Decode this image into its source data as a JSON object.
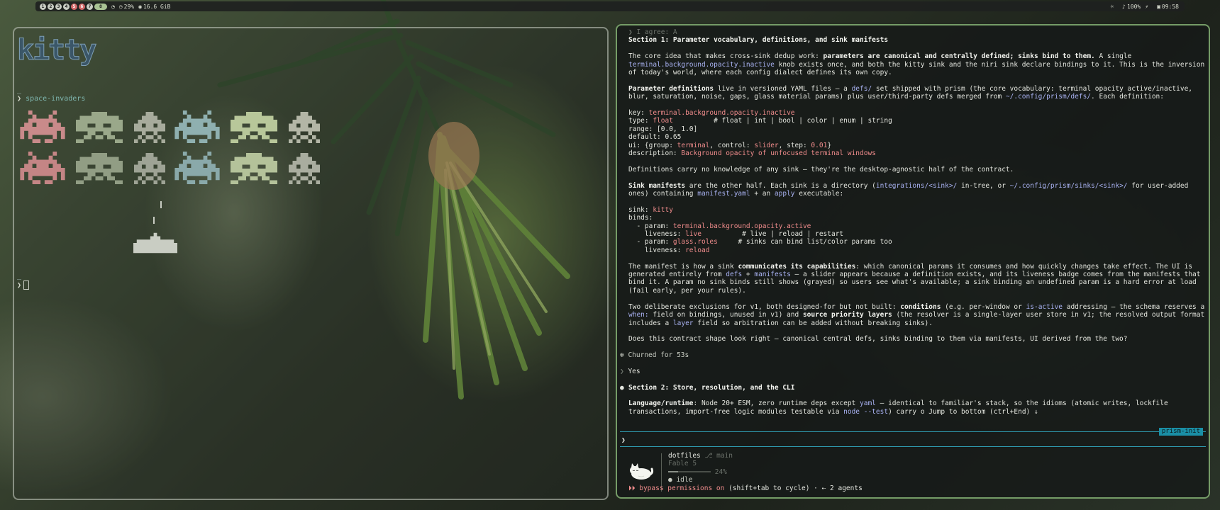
{
  "colors": {
    "accent_blue": "#a9b2f2",
    "accent_pink": "#f08c8c",
    "accent_yellow": "#e8d27e",
    "frame_green": "#96c882",
    "separator_teal": "#2f9bb0"
  },
  "topbar": {
    "workspaces": [
      "1",
      "2",
      "3",
      "4",
      "5",
      "6",
      "7",
      "8"
    ],
    "alert_workspaces": [
      "5",
      "6"
    ],
    "active_workspace": "8",
    "battery": "29%",
    "memory": "16.6 GiB",
    "volume": "100%",
    "clock": "09:58",
    "icons": [
      "speed-icon",
      "memory-icon",
      "brightness-icon",
      "volume-icon",
      "network-icon",
      "battery-icon"
    ]
  },
  "left_terminal": {
    "logo_text": "kitty",
    "prompt_symbol": "❯",
    "command": "space-invaders",
    "underscore": "_",
    "underscore2": "_",
    "prompt2": "❯"
  },
  "right_terminal": {
    "prev_prompt": "❯ I agree: A",
    "section1_title": "Section 1: Parameter vocabulary, definitions, and sink manifests",
    "p1_a": "The core idea that makes cross-sink dedup work: ",
    "p1_b": "parameters are canonical and centrally defined; sinks bind to them.",
    "p1_c": " A single ",
    "p1_d": "terminal.background.opacity.inactive",
    "p1_e": " knob exists once, and both the kitty sink and the niri sink declare bindings to it. This is the inversion of today's world, where each config dialect defines its own copy.",
    "p2_a": "Parameter definitions",
    "p2_b": " live in versioned YAML files — a ",
    "p2_c": "defs/",
    "p2_d": " set shipped with prism (the core vocabulary: terminal opacity active/inactive, blur, saturation, noise, gaps, glass material params) plus user/third-party defs merged from ",
    "p2_e": "~/.config/prism/defs/",
    "p2_f": ". Each definition:",
    "def_key_label": "key: ",
    "def_key_value": "terminal.background.opacity.inactive",
    "def_type_label": "type: ",
    "def_type_value": "float",
    "def_type_comment": "          # float | int | bool | color | enum | string",
    "def_range": "range: [0.0, 1.0]",
    "def_default": "default: 0.65",
    "def_ui_a": "ui: {group: ",
    "def_ui_b": "terminal",
    "def_ui_c": ", control: ",
    "def_ui_d": "slider",
    "def_ui_e": ", step: ",
    "def_ui_f": "0.01",
    "def_ui_g": "}",
    "def_desc_label": "description: ",
    "def_desc_value": "Background opacity of unfocused terminal windows",
    "p3": "Definitions carry no knowledge of any sink — they're the desktop-agnostic half of the contract.",
    "p4_a": "Sink manifests",
    "p4_b": " are the other half. Each sink is a directory (",
    "p4_c": "integrations/<sink>/",
    "p4_d": " in-tree, or ",
    "p4_e": "~/.config/prism/sinks/<sink>/",
    "p4_f": " for user-added ones) containing ",
    "p4_g": "manifest.yaml",
    "p4_h": " + an ",
    "p4_i": "apply",
    "p4_j": " executable:",
    "m_sink_label": "sink: ",
    "m_sink_value": "kitty",
    "m_binds": "binds:",
    "m_param1_label": "  - param: ",
    "m_param1_value": "terminal.background.opacity.active",
    "m_live1_label": "    liveness: ",
    "m_live1_value": "live",
    "m_live1_comment": "          # live | reload | restart",
    "m_param2_label": "  - param: ",
    "m_param2_value": "glass.roles",
    "m_param2_comment": "     # sinks can bind list/color params too",
    "m_live2_label": "    liveness: ",
    "m_live2_value": "reload",
    "p5_a": "The manifest is how a sink ",
    "p5_b": "communicates its capabilities",
    "p5_c": ": which canonical params it consumes and how quickly changes take effect. The UI is generated entirely from ",
    "p5_d": "defs",
    "p5_e": " + ",
    "p5_f": "manifests",
    "p5_g": " — a slider appears because a definition exists, and its liveness badge comes from the manifests that bind it. A param no sink binds still shows (grayed) so users see what's available; a sink binding an undefined param is a hard error at load (fail early, per your rules).",
    "p6_a": "Two deliberate exclusions for v1, both designed-for but not built: ",
    "p6_b": "conditions",
    "p6_c": " (e.g. per-window or ",
    "p6_d": "is-active",
    "p6_e": " addressing — the schema reserves a ",
    "p6_f": "when:",
    "p6_g": " field on bindings, unused in v1) and ",
    "p6_h": "source priority layers",
    "p6_i": " (the resolver is a single-layer user store in v1; the resolved output format includes a ",
    "p6_j": "layer",
    "p6_k": " field so arbitration can be added without breaking sinks).",
    "p7": "Does this contract shape look right — canonical central defs, sinks binding to them via manifests, UI derived from the two?",
    "churned": "✻ Churned for 53s",
    "yes_prompt": "❯ ",
    "yes_text": "Yes",
    "section2_bullet": "●",
    "section2_title": "Section 2: Store, resolution, and the CLI",
    "p8_a": "Language/runtime",
    "p8_b": ": Node 20+ ESM, zero runtime deps except ",
    "p8_c": "yaml",
    "p8_d": " — identical to familiar's stack, so the idioms (atomic writes, lockfile transactions, import-free logic modules testable via ",
    "p8_e": "node --test",
    "p8_f": ") carry o",
    "p8_g": " Jump to bottom (ctrl+End) ↓",
    "tag": "prism-init",
    "input_prompt": "❯",
    "status_repo": "dotfiles",
    "status_branch": " ⎇ main",
    "status_model": "Fable 5",
    "status_progress_text": "24%",
    "status_progress": 0.24,
    "status_state": "● idle",
    "bypass_a": "⏵⏵ bypass permissions on",
    "bypass_b": " (shift+tab to cycle) · ⇠ 2 agents"
  }
}
